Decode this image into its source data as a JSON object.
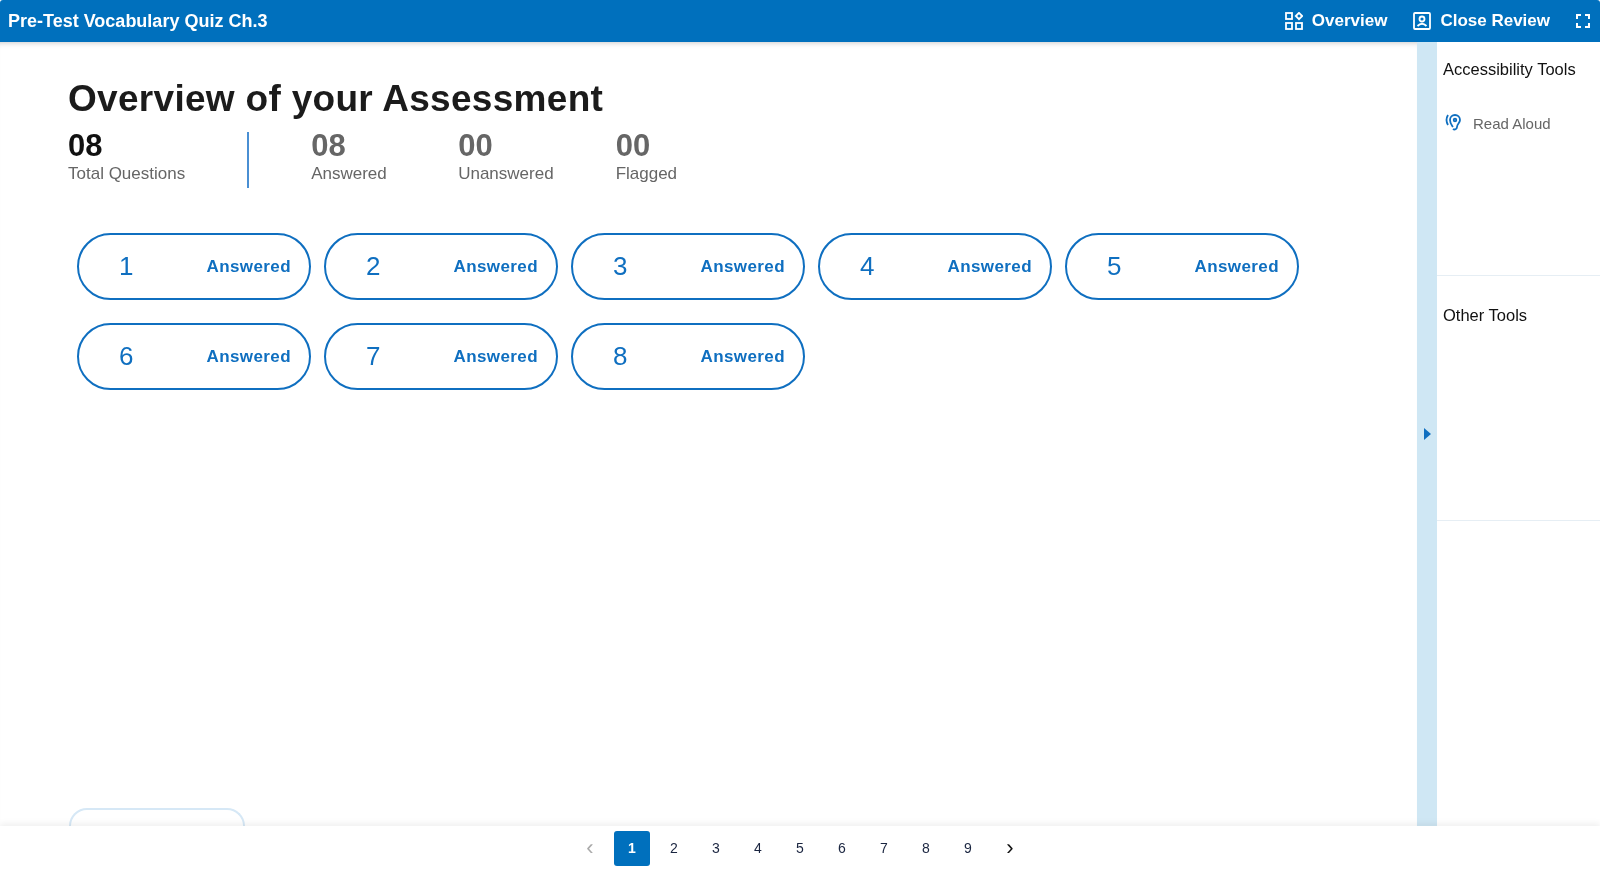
{
  "header": {
    "title": "Pre-Test Vocabulary Quiz Ch.3",
    "actions": [
      {
        "kind": "overview",
        "label": "Overview"
      },
      {
        "kind": "close",
        "label": "Close Review"
      },
      {
        "kind": "fullscreen"
      }
    ]
  },
  "overview": {
    "heading": "Overview of your Assessment",
    "stats": [
      {
        "value": "08",
        "label": "Total Questions",
        "kind": "total"
      },
      {
        "value": "08",
        "label": "Answered",
        "kind": "count"
      },
      {
        "value": "00",
        "label": "Unanswered",
        "kind": "count"
      },
      {
        "value": "00",
        "label": "Flagged",
        "kind": "count"
      }
    ],
    "questions": [
      {
        "number": "1",
        "status": "Answered"
      },
      {
        "number": "2",
        "status": "Answered"
      },
      {
        "number": "3",
        "status": "Answered"
      },
      {
        "number": "4",
        "status": "Answered"
      },
      {
        "number": "5",
        "status": "Answered"
      },
      {
        "number": "6",
        "status": "Answered"
      },
      {
        "number": "7",
        "status": "Answered"
      },
      {
        "number": "8",
        "status": "Answered"
      }
    ]
  },
  "sidebar": {
    "sections": [
      {
        "title": "Accessibility Tools",
        "items": [
          {
            "label": "Read Aloud"
          }
        ]
      },
      {
        "title": "Other Tools"
      }
    ]
  },
  "pagination": {
    "prev": "‹",
    "next": "›",
    "pages": [
      {
        "label": "1",
        "selected": true
      },
      {
        "label": "2",
        "selected": false
      },
      {
        "label": "3",
        "selected": false
      },
      {
        "label": "4",
        "selected": false
      },
      {
        "label": "5",
        "selected": false
      },
      {
        "label": "6",
        "selected": false
      },
      {
        "label": "7",
        "selected": false
      },
      {
        "label": "8",
        "selected": false
      },
      {
        "label": "9",
        "selected": false
      }
    ]
  }
}
